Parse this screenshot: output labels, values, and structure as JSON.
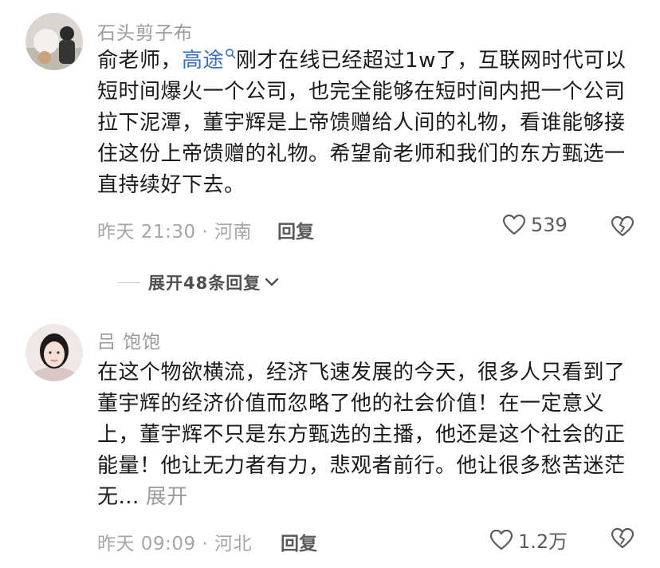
{
  "comments": [
    {
      "username": "石头剪子布",
      "text_before": "俞老师，",
      "mention": "高途",
      "text_after": "刚才在线已经超过1w了，互联网时代可以短时间爆火一个公司，也完全能够在短时间内把一个公司拉下泥潭，董宇辉是上帝馈赠给人间的礼物，看谁能够接住这份上帝馈赠的礼物。希望俞老师和我们的东方甄选一直持续好下去。",
      "time_location": "昨天 21:30 · 河南",
      "reply_label": "回复",
      "likes": "539"
    },
    {
      "username": "吕 饱饱",
      "text": "在这个物欲横流，经济飞速发展的今天，很多人只看到了董宇辉的经济价值而忽略了他的社会价值！在一定意义上，董宇辉不只是东方甄选的主播，他还是这个社会的正能量！他让无力者有力，悲观者前行。他让很多愁苦迷茫无...",
      "expand_label": "展开",
      "time_location": "昨天 09:09 · 河北",
      "reply_label": "回复",
      "likes": "1.2万"
    }
  ],
  "expand_replies": "展开48条回复",
  "icons": {
    "like": "heart-outline-icon",
    "dislike": "broken-heart-icon",
    "chevron": "chevron-down-icon",
    "mention": "search-icon"
  },
  "colors": {
    "mention": "#3b6fb6",
    "meta": "#a6a6a6"
  }
}
